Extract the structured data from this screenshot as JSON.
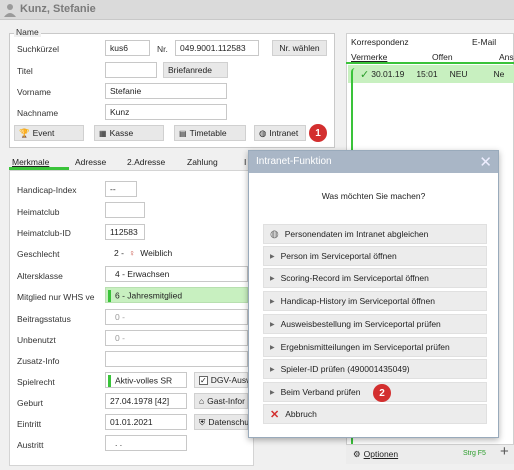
{
  "window": {
    "title": "Kunz, Stefanie"
  },
  "name_group": {
    "label": "Name",
    "suchkuerzel_label": "Suchkürzel",
    "suchkuerzel_value": "kus6",
    "nr_label": "Nr.",
    "nr_value": "049.9001.112583",
    "nr_button": "Nr. wählen",
    "titel_label": "Titel",
    "titel_value": "",
    "briefanrede_button": "Briefanrede",
    "vorname_label": "Vorname",
    "vorname_value": "Stefanie",
    "nachname_label": "Nachname",
    "nachname_value": "Kunz"
  },
  "toolbar": {
    "event": "Event",
    "kasse": "Kasse",
    "timetable": "Timetable",
    "intranet": "Intranet"
  },
  "tabs": [
    "Merkmale",
    "Adresse",
    "2.Adresse",
    "Zahlung",
    "I"
  ],
  "fields": {
    "handicap_index_label": "Handicap-Index",
    "handicap_index_value": "--",
    "heimatclub_label": "Heimatclub",
    "heimatclub_value": "",
    "heimatclub_id_label": "Heimatclub-ID",
    "heimatclub_id_value": "112583",
    "geschlecht_label": "Geschlecht",
    "geschlecht_code": "2 -",
    "geschlecht_value": "Weiblich",
    "altersklasse_label": "Altersklasse",
    "altersklasse_value": "4 - Erwachsen",
    "mitglied_label": "Mitglied nur WHS ve",
    "mitglied_value": "6 - Jahresmitglied",
    "beitragsstatus_label": "Beitragsstatus",
    "beitragsstatus_value": "0 -",
    "unbenutzt_label": "Unbenutzt",
    "unbenutzt_value": "0 -",
    "zusatz_label": "Zusatz-Info",
    "zusatz_value": "",
    "spielrecht_label": "Spielrecht",
    "spielrecht_value": "Aktiv-volles SR",
    "dgv_label": "DGV-Ausw",
    "geburt_label": "Geburt",
    "geburt_value": "27.04.1978  [42]",
    "gast_label": "Gast-Infor",
    "eintritt_label": "Eintritt",
    "eintritt_value": "01.01.2021",
    "datenschutz_label": "Datenschu",
    "austritt_label": "Austritt",
    "austritt_value": ". ."
  },
  "right_panel": {
    "tabs_row1": [
      "Korrespondenz",
      "E-Mail"
    ],
    "tabs_row2": [
      "Vermerke",
      "Offen",
      "Ans"
    ],
    "row": {
      "date": "30.01.19",
      "time": "15:01",
      "status": "NEU",
      "extra": "Ne"
    },
    "footer_options": "Optionen",
    "footer_shortcut": "Strg F5",
    "footer_plus": "+"
  },
  "dialog": {
    "title": "Intranet-Funktion",
    "question": "Was möchten Sie machen?",
    "items": [
      "Personendaten im Intranet abgleichen",
      "Person im Serviceportal öffnen",
      "Scoring-Record im Serviceportal öffnen",
      "Handicap-History im Serviceportal öffnen",
      "Ausweisbestellung im Serviceportal prüfen",
      "Ergebnismitteilungen im Serviceportal prüfen",
      "Spieler-ID prüfen (490001435049)",
      "Beim Verband prüfen",
      "Abbruch"
    ]
  },
  "badges": {
    "one": "1",
    "two": "2"
  },
  "colors": {
    "accent_green": "#3ac33a",
    "badge_red": "#d32f2f",
    "dialog_title": "#a9b6c6",
    "row_highlight": "#c8f0c0"
  }
}
